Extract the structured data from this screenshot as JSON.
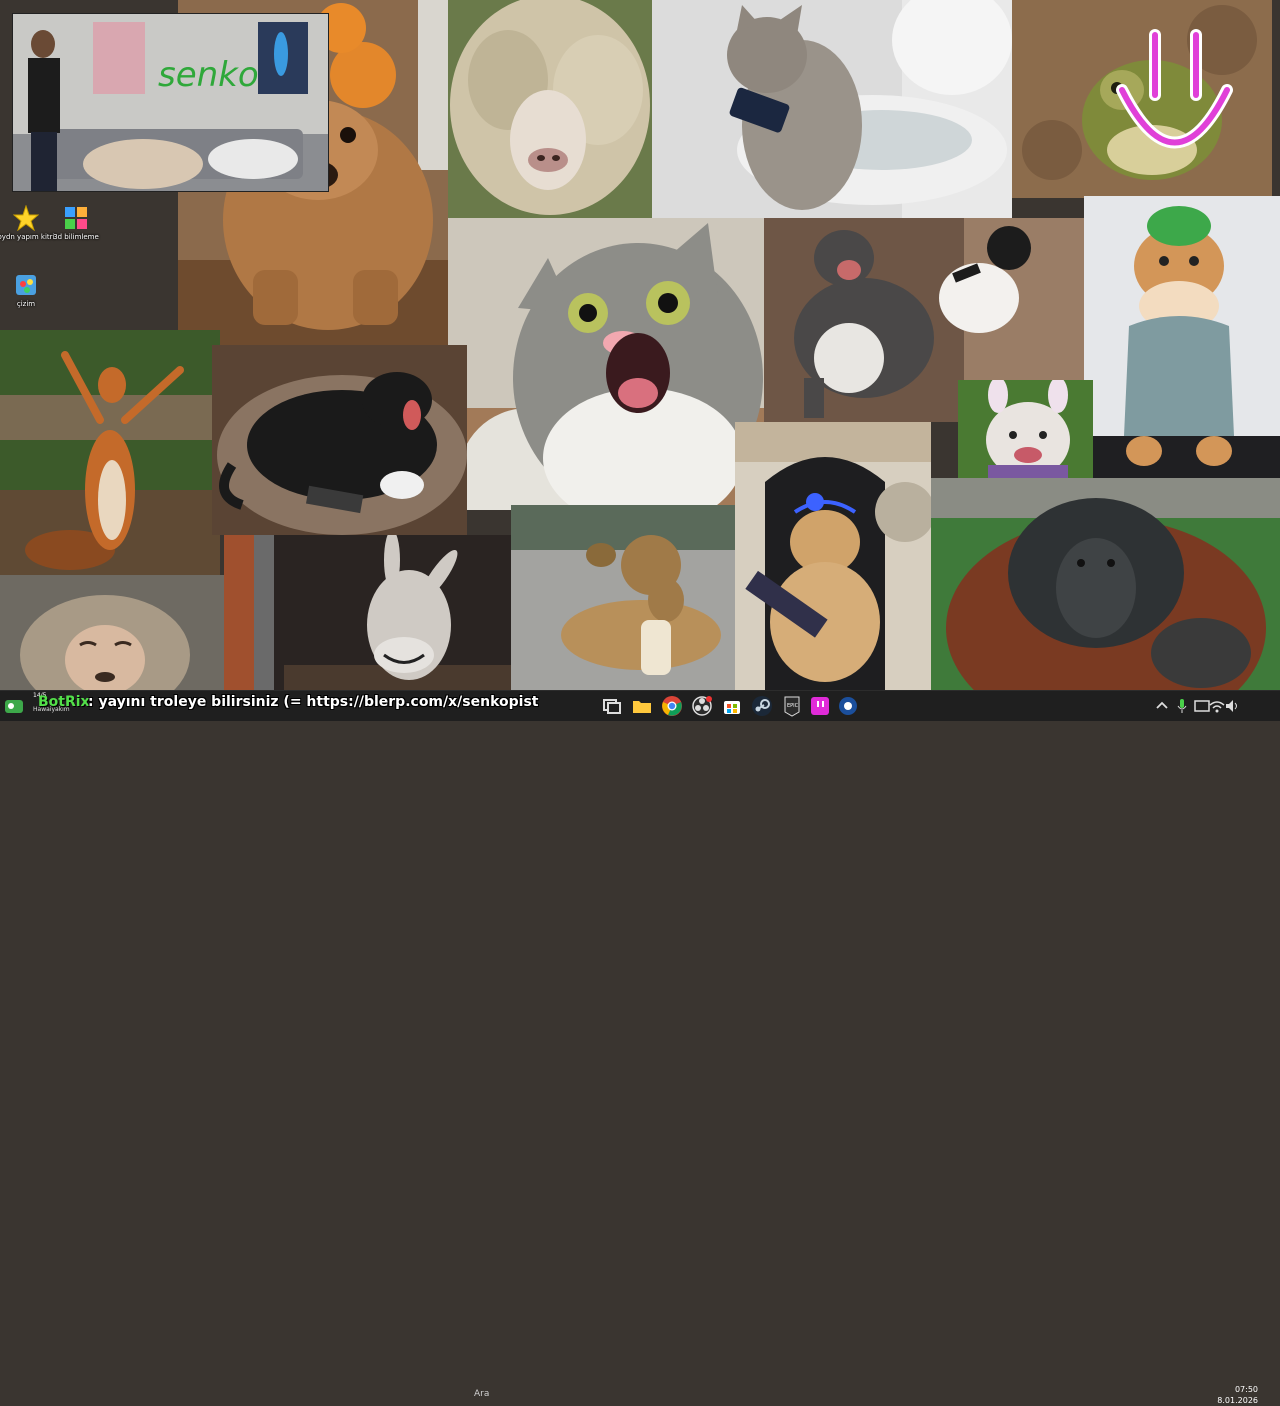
{
  "webcam": {
    "sign_text": "senko"
  },
  "desktop": {
    "icons": [
      {
        "label": "oydn yapım kitri",
        "icon": "star-icon"
      },
      {
        "label": "3d bilimleme",
        "icon": "puzzle-icon"
      },
      {
        "label": "çizim",
        "icon": "paint-icon"
      }
    ]
  },
  "collage": {
    "tiles": [
      "dog-with-orange-photo",
      "fluffy-sheep-photo",
      "cat-on-toilet-with-phone-photo",
      "frog-with-smiley-photo",
      "shocked-cat-photo",
      "dog-and-cat-fighting-photo",
      "cat-in-green-hat-photo",
      "squirrel-arms-raised-photo",
      "dog-with-controller-photo",
      "bulldog-bunny-ears-photo",
      "monkey-eyes-closed-photo",
      "donkey-smiling-photo",
      "dog-eating-bread-photo",
      "gamer-cat-headset-photo",
      "orangutan-photo"
    ]
  },
  "stream_overlay": {
    "botrix_name": "BotRix",
    "message": ": yayını troleye bilirsiniz (= https://blerp.com/x/senkopist",
    "viewer_count": "14/5",
    "user_tag": "Hawaiyakım"
  },
  "taskbar": {
    "search_placeholder": "Ara",
    "apps": [
      "widgets-icon",
      "task-view-icon",
      "file-explorer-icon",
      "chrome-icon",
      "obs-icon",
      "microsoft-store-icon",
      "steam-icon",
      "epic-games-icon",
      "twitch-icon",
      "steam-link-icon"
    ],
    "tray": [
      "chevron-up-icon",
      "microphone-icon",
      "display-icon",
      "wifi-icon",
      "volume-icon",
      "battery-icon"
    ],
    "time": "07:50",
    "date": "8.01.2026"
  },
  "colors": {
    "taskbar": "#1f1f1f",
    "botrix_green": "#53e04a",
    "smiley_pink": "#e040d8"
  }
}
